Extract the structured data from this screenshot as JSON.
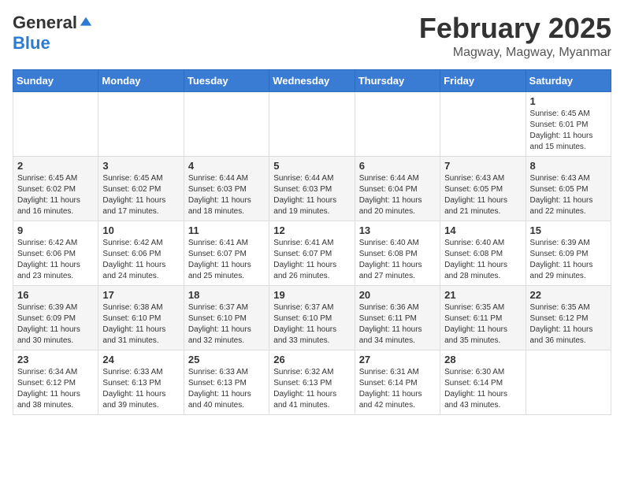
{
  "logo": {
    "general": "General",
    "blue": "Blue"
  },
  "header": {
    "month": "February 2025",
    "location": "Magway, Magway, Myanmar"
  },
  "weekdays": [
    "Sunday",
    "Monday",
    "Tuesday",
    "Wednesday",
    "Thursday",
    "Friday",
    "Saturday"
  ],
  "weeks": [
    [
      {
        "day": "",
        "info": ""
      },
      {
        "day": "",
        "info": ""
      },
      {
        "day": "",
        "info": ""
      },
      {
        "day": "",
        "info": ""
      },
      {
        "day": "",
        "info": ""
      },
      {
        "day": "",
        "info": ""
      },
      {
        "day": "1",
        "info": "Sunrise: 6:45 AM\nSunset: 6:01 PM\nDaylight: 11 hours\nand 15 minutes."
      }
    ],
    [
      {
        "day": "2",
        "info": "Sunrise: 6:45 AM\nSunset: 6:02 PM\nDaylight: 11 hours\nand 16 minutes."
      },
      {
        "day": "3",
        "info": "Sunrise: 6:45 AM\nSunset: 6:02 PM\nDaylight: 11 hours\nand 17 minutes."
      },
      {
        "day": "4",
        "info": "Sunrise: 6:44 AM\nSunset: 6:03 PM\nDaylight: 11 hours\nand 18 minutes."
      },
      {
        "day": "5",
        "info": "Sunrise: 6:44 AM\nSunset: 6:03 PM\nDaylight: 11 hours\nand 19 minutes."
      },
      {
        "day": "6",
        "info": "Sunrise: 6:44 AM\nSunset: 6:04 PM\nDaylight: 11 hours\nand 20 minutes."
      },
      {
        "day": "7",
        "info": "Sunrise: 6:43 AM\nSunset: 6:05 PM\nDaylight: 11 hours\nand 21 minutes."
      },
      {
        "day": "8",
        "info": "Sunrise: 6:43 AM\nSunset: 6:05 PM\nDaylight: 11 hours\nand 22 minutes."
      }
    ],
    [
      {
        "day": "9",
        "info": "Sunrise: 6:42 AM\nSunset: 6:06 PM\nDaylight: 11 hours\nand 23 minutes."
      },
      {
        "day": "10",
        "info": "Sunrise: 6:42 AM\nSunset: 6:06 PM\nDaylight: 11 hours\nand 24 minutes."
      },
      {
        "day": "11",
        "info": "Sunrise: 6:41 AM\nSunset: 6:07 PM\nDaylight: 11 hours\nand 25 minutes."
      },
      {
        "day": "12",
        "info": "Sunrise: 6:41 AM\nSunset: 6:07 PM\nDaylight: 11 hours\nand 26 minutes."
      },
      {
        "day": "13",
        "info": "Sunrise: 6:40 AM\nSunset: 6:08 PM\nDaylight: 11 hours\nand 27 minutes."
      },
      {
        "day": "14",
        "info": "Sunrise: 6:40 AM\nSunset: 6:08 PM\nDaylight: 11 hours\nand 28 minutes."
      },
      {
        "day": "15",
        "info": "Sunrise: 6:39 AM\nSunset: 6:09 PM\nDaylight: 11 hours\nand 29 minutes."
      }
    ],
    [
      {
        "day": "16",
        "info": "Sunrise: 6:39 AM\nSunset: 6:09 PM\nDaylight: 11 hours\nand 30 minutes."
      },
      {
        "day": "17",
        "info": "Sunrise: 6:38 AM\nSunset: 6:10 PM\nDaylight: 11 hours\nand 31 minutes."
      },
      {
        "day": "18",
        "info": "Sunrise: 6:37 AM\nSunset: 6:10 PM\nDaylight: 11 hours\nand 32 minutes."
      },
      {
        "day": "19",
        "info": "Sunrise: 6:37 AM\nSunset: 6:10 PM\nDaylight: 11 hours\nand 33 minutes."
      },
      {
        "day": "20",
        "info": "Sunrise: 6:36 AM\nSunset: 6:11 PM\nDaylight: 11 hours\nand 34 minutes."
      },
      {
        "day": "21",
        "info": "Sunrise: 6:35 AM\nSunset: 6:11 PM\nDaylight: 11 hours\nand 35 minutes."
      },
      {
        "day": "22",
        "info": "Sunrise: 6:35 AM\nSunset: 6:12 PM\nDaylight: 11 hours\nand 36 minutes."
      }
    ],
    [
      {
        "day": "23",
        "info": "Sunrise: 6:34 AM\nSunset: 6:12 PM\nDaylight: 11 hours\nand 38 minutes."
      },
      {
        "day": "24",
        "info": "Sunrise: 6:33 AM\nSunset: 6:13 PM\nDaylight: 11 hours\nand 39 minutes."
      },
      {
        "day": "25",
        "info": "Sunrise: 6:33 AM\nSunset: 6:13 PM\nDaylight: 11 hours\nand 40 minutes."
      },
      {
        "day": "26",
        "info": "Sunrise: 6:32 AM\nSunset: 6:13 PM\nDaylight: 11 hours\nand 41 minutes."
      },
      {
        "day": "27",
        "info": "Sunrise: 6:31 AM\nSunset: 6:14 PM\nDaylight: 11 hours\nand 42 minutes."
      },
      {
        "day": "28",
        "info": "Sunrise: 6:30 AM\nSunset: 6:14 PM\nDaylight: 11 hours\nand 43 minutes."
      },
      {
        "day": "",
        "info": ""
      }
    ]
  ]
}
